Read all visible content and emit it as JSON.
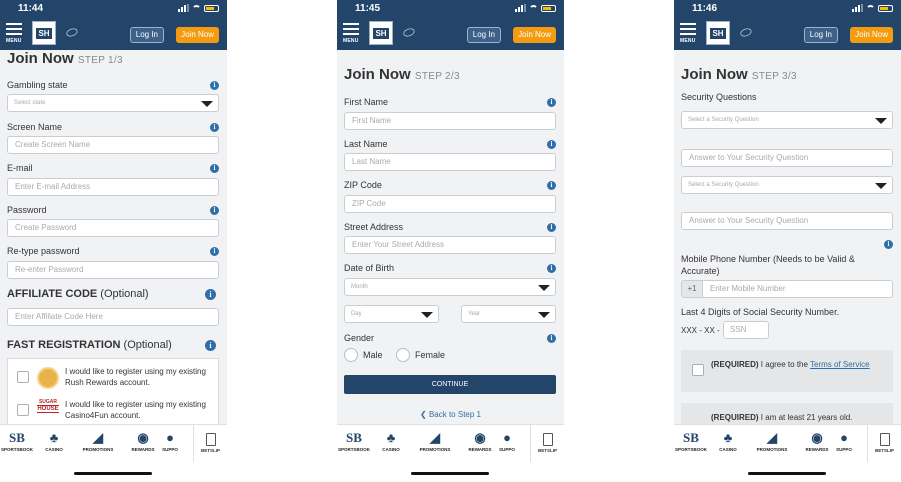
{
  "status_times": [
    "11:44",
    "11:45",
    "11:46"
  ],
  "nav": {
    "menu_label": "MENU",
    "logo_text": "SH",
    "login_label": "Log In",
    "join_label": "Join Now"
  },
  "bottom_nav": {
    "sportsbook": "SPORTSBOOK",
    "casino": "CASINO",
    "promotions": "PROMOTIONS",
    "rewards": "REWARDS",
    "support": "SUPPO",
    "betslip": "BETSLIP"
  },
  "step1": {
    "title": "Join Now",
    "step": "STEP 1/3",
    "gambling_state": {
      "label": "Gambling state",
      "placeholder": "Select state"
    },
    "screen_name": {
      "label": "Screen Name",
      "placeholder": "Create Screen Name"
    },
    "email": {
      "label": "E-mail",
      "placeholder": "Enter E-mail Address"
    },
    "password": {
      "label": "Password",
      "placeholder": "Create Password"
    },
    "retype": {
      "label": "Re-type password",
      "placeholder": "Re-enter Password"
    },
    "affiliate": {
      "heading": "AFFILIATE CODE",
      "optional": "(Optional)",
      "placeholder": "Enter Affiliate Code Here"
    },
    "fast_reg": {
      "heading": "FAST REGISTRATION",
      "optional": "(Optional)"
    },
    "rush_text": "I would like to register using my existing Rush Rewards account.",
    "sugar_logo_top": "SUGAR",
    "sugar_logo_bottom": "HOUSE",
    "casino4fun_text": "I would like to register using my existing Casino4Fun account."
  },
  "step2": {
    "title": "Join Now",
    "step": "STEP 2/3",
    "first_name": {
      "label": "First Name",
      "placeholder": "First Name"
    },
    "last_name": {
      "label": "Last Name",
      "placeholder": "Last Name"
    },
    "zip": {
      "label": "ZIP Code",
      "placeholder": "ZIP Code"
    },
    "street": {
      "label": "Street Address",
      "placeholder": "Enter Your Street Address"
    },
    "dob": {
      "label": "Date of Birth",
      "month": "Month",
      "day": "Day",
      "year": "Year"
    },
    "gender": {
      "label": "Gender",
      "male": "Male",
      "female": "Female"
    },
    "continue_label": "CONTINUE",
    "back_label": "Back to Step 1"
  },
  "step3": {
    "title": "Join Now",
    "step": "STEP 3/3",
    "security_label": "Security Questions",
    "select_q": "Select a Security Question",
    "answer_placeholder": "Answer to Your Security Question",
    "mobile_label": "Mobile Phone Number (Needs to be Valid & Accurate)",
    "country_code": "+1",
    "mobile_placeholder": "Enter Mobile Number",
    "ssn_label": "Last 4 Digits of Social Security Number.",
    "ssn_prefix": "XXX - XX -",
    "ssn_placeholder": "SSN",
    "terms_required": "(REQUIRED)",
    "terms_text": "I agree to the",
    "terms_link": "Terms of Service",
    "age_required": "(REQUIRED)",
    "age_text": "I am at least 21 years old."
  }
}
